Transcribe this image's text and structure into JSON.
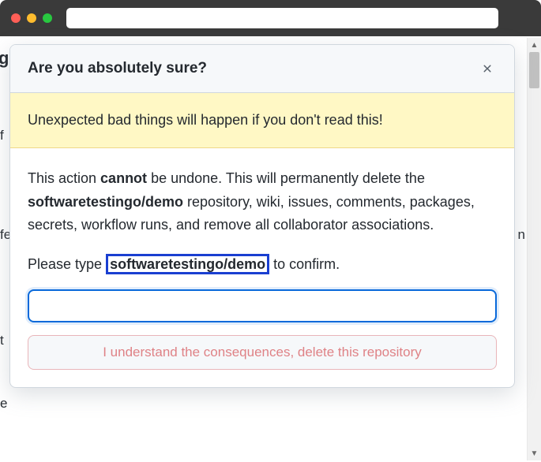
{
  "modal": {
    "title": "Are you absolutely sure?",
    "warning": "Unexpected bad things will happen if you don't read this!",
    "body": {
      "pre_cannot": "This action ",
      "cannot": "cannot",
      "post_cannot": " be undone. This will permanently delete the ",
      "repo_full": "softwaretestingo/demo",
      "after_repo": " repository, wiki, issues, comments, packages, secrets, workflow runs, and remove all collaborator associations."
    },
    "confirm": {
      "pre": "Please type ",
      "highlight": "softwaretestingo/demo",
      "post": " to confirm."
    },
    "input_value": "",
    "delete_button": "I understand the consequences, delete this repository"
  },
  "background": {
    "frag1": "g",
    "frag2": "f",
    "frag3": "fe",
    "frag4": "t",
    "frag5": "e"
  }
}
